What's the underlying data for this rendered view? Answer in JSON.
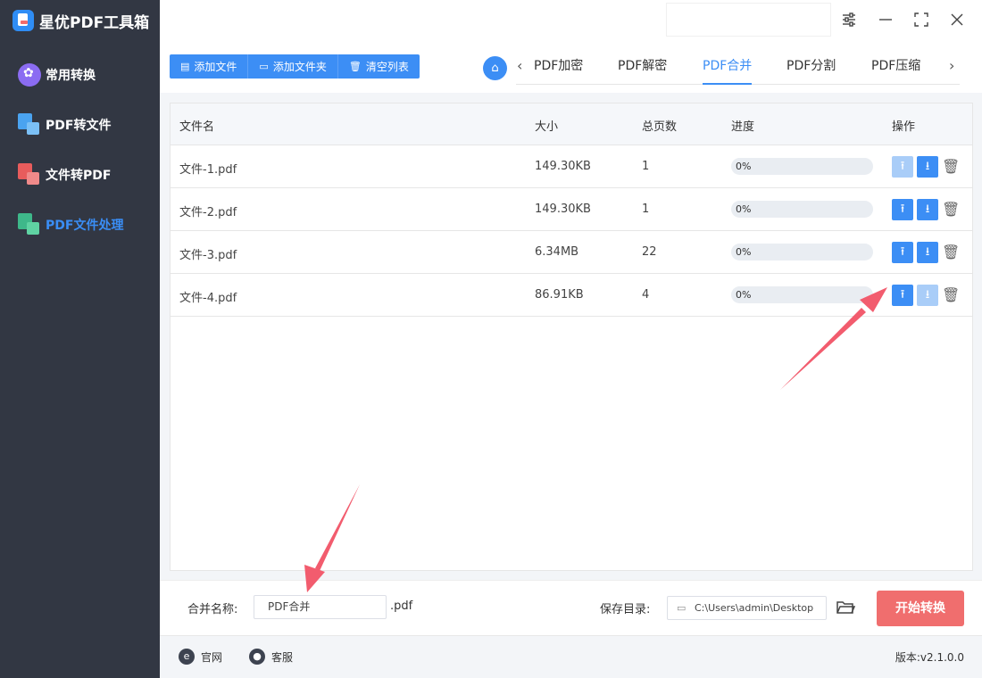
{
  "app": {
    "title": "星优PDF工具箱"
  },
  "sidebar": {
    "items": [
      {
        "label": "常用转换"
      },
      {
        "label": "PDF转文件"
      },
      {
        "label": "文件转PDF"
      },
      {
        "label": "PDF文件处理"
      }
    ]
  },
  "toolbar": {
    "add_file": "添加文件",
    "add_folder": "添加文件夹",
    "clear_list": "清空列表"
  },
  "tabs": [
    {
      "label": "PDF加密"
    },
    {
      "label": "PDF解密"
    },
    {
      "label": "PDF合并"
    },
    {
      "label": "PDF分割"
    },
    {
      "label": "PDF压缩"
    }
  ],
  "table": {
    "columns": [
      "文件名",
      "大小",
      "总页数",
      "进度",
      "操作"
    ],
    "rows": [
      {
        "name": "文件-1.pdf",
        "size": "149.30KB",
        "pages": "1",
        "progress": "0%"
      },
      {
        "name": "文件-2.pdf",
        "size": "149.30KB",
        "pages": "1",
        "progress": "0%"
      },
      {
        "name": "文件-3.pdf",
        "size": "6.34MB",
        "pages": "22",
        "progress": "0%"
      },
      {
        "name": "文件-4.pdf",
        "size": "86.91KB",
        "pages": "4",
        "progress": "0%"
      }
    ]
  },
  "bottom": {
    "merge_label": "合并名称:",
    "merge_value": "PDF合并",
    "merge_ext": ".pdf",
    "save_label": "保存目录:",
    "save_path": "C:\\Users\\admin\\Desktop",
    "start_label": "开始转换"
  },
  "footer": {
    "website": "官网",
    "service": "客服",
    "version": "版本:v2.1.0.0"
  },
  "colors": {
    "accent": "#3c8ef5",
    "sidebar": "#323743",
    "start": "#f06e6e",
    "arrow": "#f25c6e"
  }
}
